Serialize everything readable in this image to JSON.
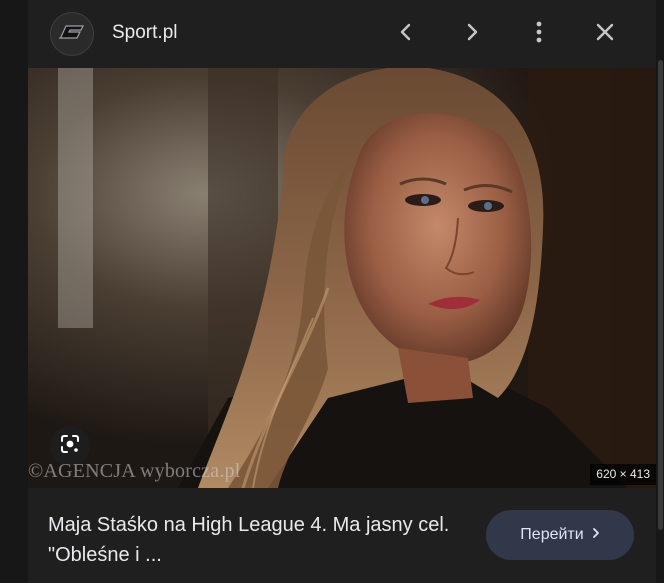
{
  "header": {
    "site_name": "Sport.pl",
    "avatar_icon": "sport-logo-icon",
    "prev_icon": "chevron-left-icon",
    "next_icon": "chevron-right-icon",
    "more_icon": "more-vert-icon",
    "close_icon": "close-icon"
  },
  "image": {
    "watermark": "©AGENCJA wyborcza.pl",
    "dimensions": "620 × 413",
    "lens_icon": "google-lens-icon"
  },
  "caption": "Maja Staśko na High League 4. Ma jasny cel. \"Obleśne i ...",
  "visit_button": {
    "label": "Перейти",
    "icon": "chevron-right-icon"
  },
  "colors": {
    "background": "#1f1f1f",
    "button_bg": "#303849",
    "text": "#e8eaed"
  }
}
